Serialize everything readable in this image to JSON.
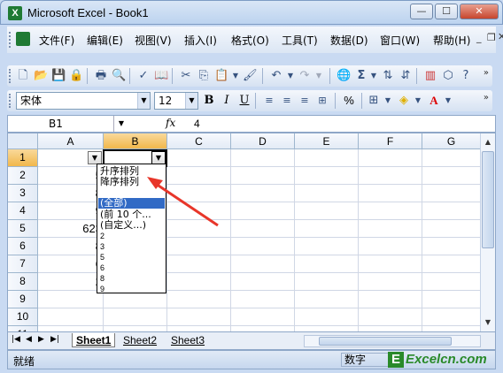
{
  "window": {
    "title": "Microsoft Excel - Book1",
    "app_icon_letter": "X"
  },
  "menu": {
    "items": [
      {
        "label": "文件(F)"
      },
      {
        "label": "编辑(E)"
      },
      {
        "label": "视图(V)"
      },
      {
        "label": "插入(I)"
      },
      {
        "label": "格式(O)"
      },
      {
        "label": "工具(T)"
      },
      {
        "label": "数据(D)"
      },
      {
        "label": "窗口(W)"
      },
      {
        "label": "帮助(H)"
      }
    ]
  },
  "formatting": {
    "font": "宋体",
    "size": "12",
    "bold": "B",
    "italic": "I",
    "underline": "U",
    "percent": "%"
  },
  "formula_bar": {
    "name_box": "B1",
    "fx": "fx",
    "value": "4"
  },
  "sheet": {
    "columns": [
      "A",
      "B",
      "C",
      "D",
      "E",
      "F",
      "G"
    ],
    "active_column": "B",
    "rows": [
      "1",
      "2",
      "3",
      "4",
      "5",
      "6",
      "7",
      "8",
      "9",
      "10",
      "11"
    ],
    "active_row": "1",
    "col_a_values": [
      "",
      "5",
      "8",
      "9",
      "623",
      "8",
      "6",
      "2",
      "",
      "",
      ""
    ]
  },
  "filter_dropdown": {
    "sort_items": [
      "升序排列",
      "降序排列"
    ],
    "filter_items": [
      "(全部)",
      "(前 10 个...",
      "(自定义...)"
    ],
    "selected": "(全部)",
    "values": [
      "2",
      "3",
      "5",
      "6",
      "8",
      "9"
    ]
  },
  "tabs": {
    "sheets": [
      "Sheet1",
      "Sheet2",
      "Sheet3"
    ],
    "active": "Sheet1"
  },
  "status": {
    "ready": "就绪",
    "num": "数字"
  },
  "watermark": {
    "letter": "E",
    "text": "Excelcn.com"
  },
  "colors": {
    "active_header": "#f1b74b",
    "selected_item": "#316ac5",
    "annotation_arrow": "#e8362a"
  }
}
